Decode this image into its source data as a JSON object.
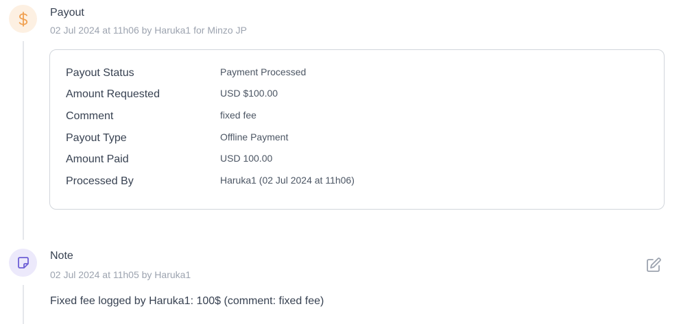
{
  "events": [
    {
      "title": "Payout",
      "meta": "02 Jul 2024 at 11h06 by Haruka1 for Minzo JP",
      "icon": "dollar-icon",
      "icon_color": "#f0a050",
      "icon_bg": "#fdf0e2",
      "details": [
        {
          "label": "Payout Status",
          "value": "Payment Processed"
        },
        {
          "label": "Amount Requested",
          "value": "USD $100.00"
        },
        {
          "label": "Comment",
          "value": "fixed fee"
        },
        {
          "label": "Payout Type",
          "value": "Offline Payment"
        },
        {
          "label": "Amount Paid",
          "value": "USD 100.00"
        },
        {
          "label": "Processed By",
          "value": "Haruka1 (02 Jul 2024 at 11h06)"
        }
      ]
    },
    {
      "title": "Note",
      "meta": "02 Jul 2024 at 11h05 by Haruka1",
      "icon": "sticky-note-icon",
      "icon_color": "#6d5fd6",
      "icon_bg": "#ece9fb",
      "body": "Fixed fee logged by Haruka1: 100$ (comment: fixed fee)",
      "edit_icon": "edit-icon"
    }
  ]
}
